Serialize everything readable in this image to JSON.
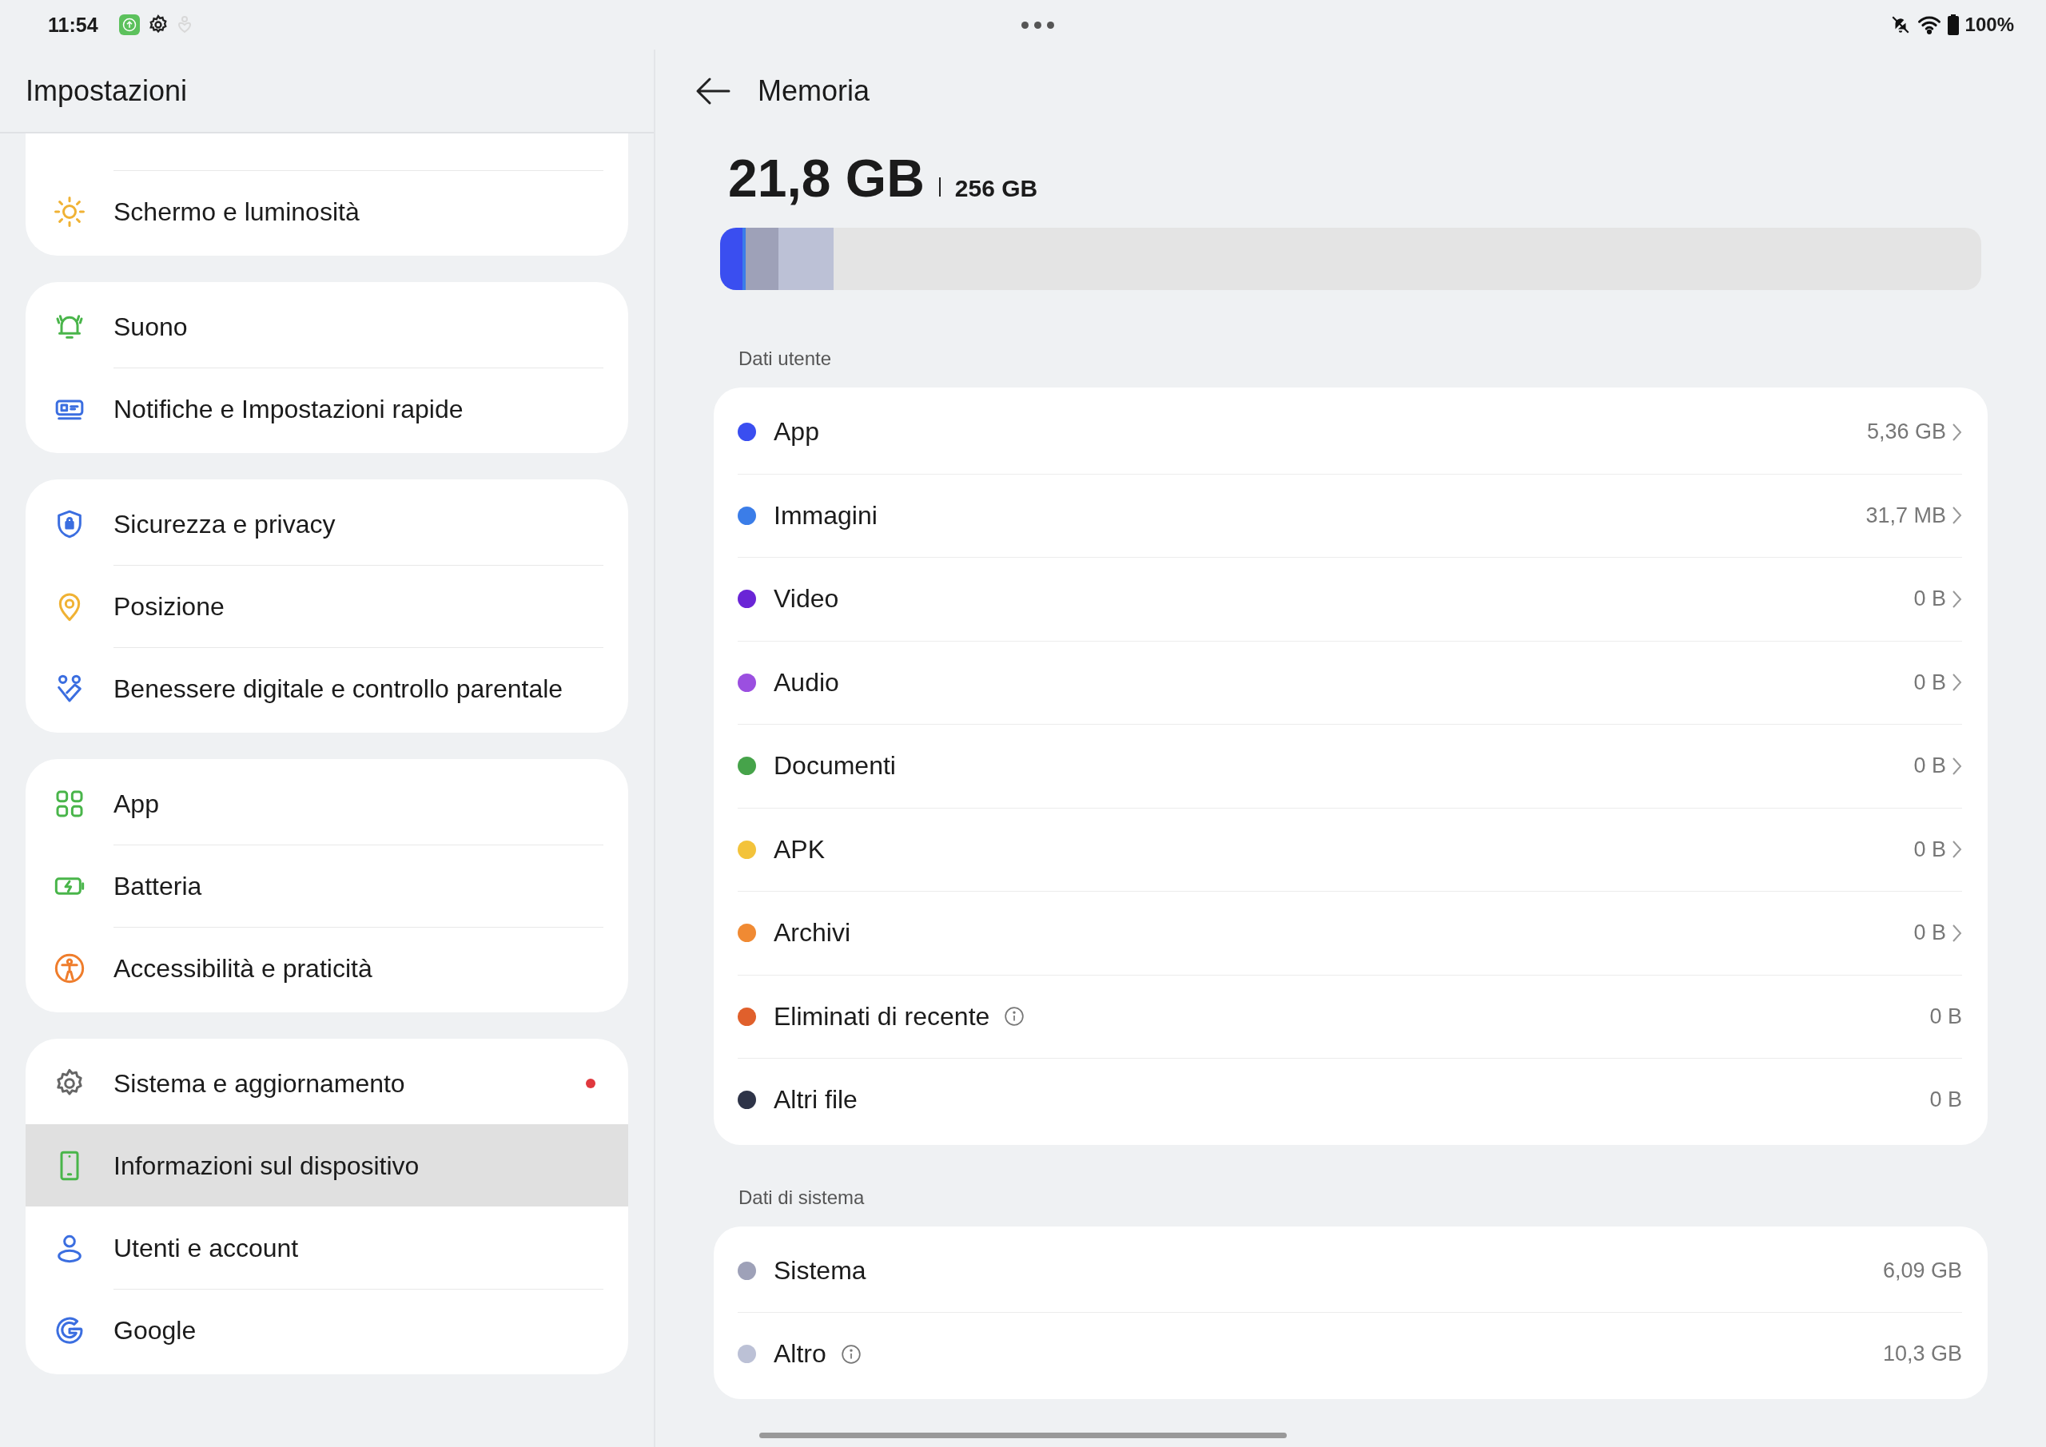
{
  "status_bar": {
    "time": "11:54",
    "battery": "100%"
  },
  "sidebar": {
    "title": "Impostazioni",
    "groups": [
      {
        "items": [
          {
            "label": "Schermo e luminosità",
            "selected": false,
            "dot": false
          }
        ]
      },
      {
        "items": [
          {
            "label": "Suono",
            "selected": false,
            "dot": false
          },
          {
            "label": "Notifiche e Impostazioni rapide",
            "selected": false,
            "dot": false
          }
        ]
      },
      {
        "items": [
          {
            "label": "Sicurezza e privacy",
            "selected": false,
            "dot": false
          },
          {
            "label": "Posizione",
            "selected": false,
            "dot": false
          },
          {
            "label": "Benessere digitale e controllo parentale",
            "selected": false,
            "dot": false
          }
        ]
      },
      {
        "items": [
          {
            "label": "App",
            "selected": false,
            "dot": false
          },
          {
            "label": "Batteria",
            "selected": false,
            "dot": false
          },
          {
            "label": "Accessibilità e praticità",
            "selected": false,
            "dot": false
          }
        ]
      },
      {
        "items": [
          {
            "label": "Sistema e aggiornamento",
            "selected": false,
            "dot": true
          },
          {
            "label": "Informazioni sul dispositivo",
            "selected": true,
            "dot": false
          },
          {
            "label": "Utenti e account",
            "selected": false,
            "dot": false
          },
          {
            "label": "Google",
            "selected": false,
            "dot": false
          }
        ]
      }
    ]
  },
  "page": {
    "title": "Memoria",
    "used": "21,8 GB",
    "total": "256 GB",
    "storage_bar": [
      {
        "color": "#3a4ef0",
        "level": 0.018
      },
      {
        "color": "#3b7de8",
        "level": 0.002
      },
      {
        "color": "#9ea1b8",
        "level": 0.026
      },
      {
        "color": "#bcc1d6",
        "level": 0.044
      }
    ],
    "sections": [
      {
        "title": "Dati utente",
        "rows": [
          {
            "label": "App",
            "value": "5,36 GB",
            "color": "#3a4ef0",
            "chevron": true,
            "info": false
          },
          {
            "label": "Immagini",
            "value": "31,7 MB",
            "color": "#3b7de8",
            "chevron": true,
            "info": false
          },
          {
            "label": "Video",
            "value": "0 B",
            "color": "#6a25d6",
            "chevron": true,
            "info": false
          },
          {
            "label": "Audio",
            "value": "0 B",
            "color": "#9b4fe0",
            "chevron": true,
            "info": false
          },
          {
            "label": "Documenti",
            "value": "0 B",
            "color": "#46a34a",
            "chevron": true,
            "info": false
          },
          {
            "label": "APK",
            "value": "0 B",
            "color": "#f3c33b",
            "chevron": true,
            "info": false
          },
          {
            "label": "Archivi",
            "value": "0 B",
            "color": "#f08a33",
            "chevron": true,
            "info": false
          },
          {
            "label": "Eliminati di recente",
            "value": "0 B",
            "color": "#e0602c",
            "chevron": false,
            "info": true
          },
          {
            "label": "Altri file",
            "value": "0 B",
            "color": "#2e3448",
            "chevron": false,
            "info": false
          }
        ]
      },
      {
        "title": "Dati di sistema",
        "rows": [
          {
            "label": "Sistema",
            "value": "6,09 GB",
            "color": "#9ea1b8",
            "chevron": false,
            "info": false
          },
          {
            "label": "Altro",
            "value": "10,3 GB",
            "color": "#bcc1d6",
            "chevron": false,
            "info": true
          }
        ]
      }
    ]
  }
}
